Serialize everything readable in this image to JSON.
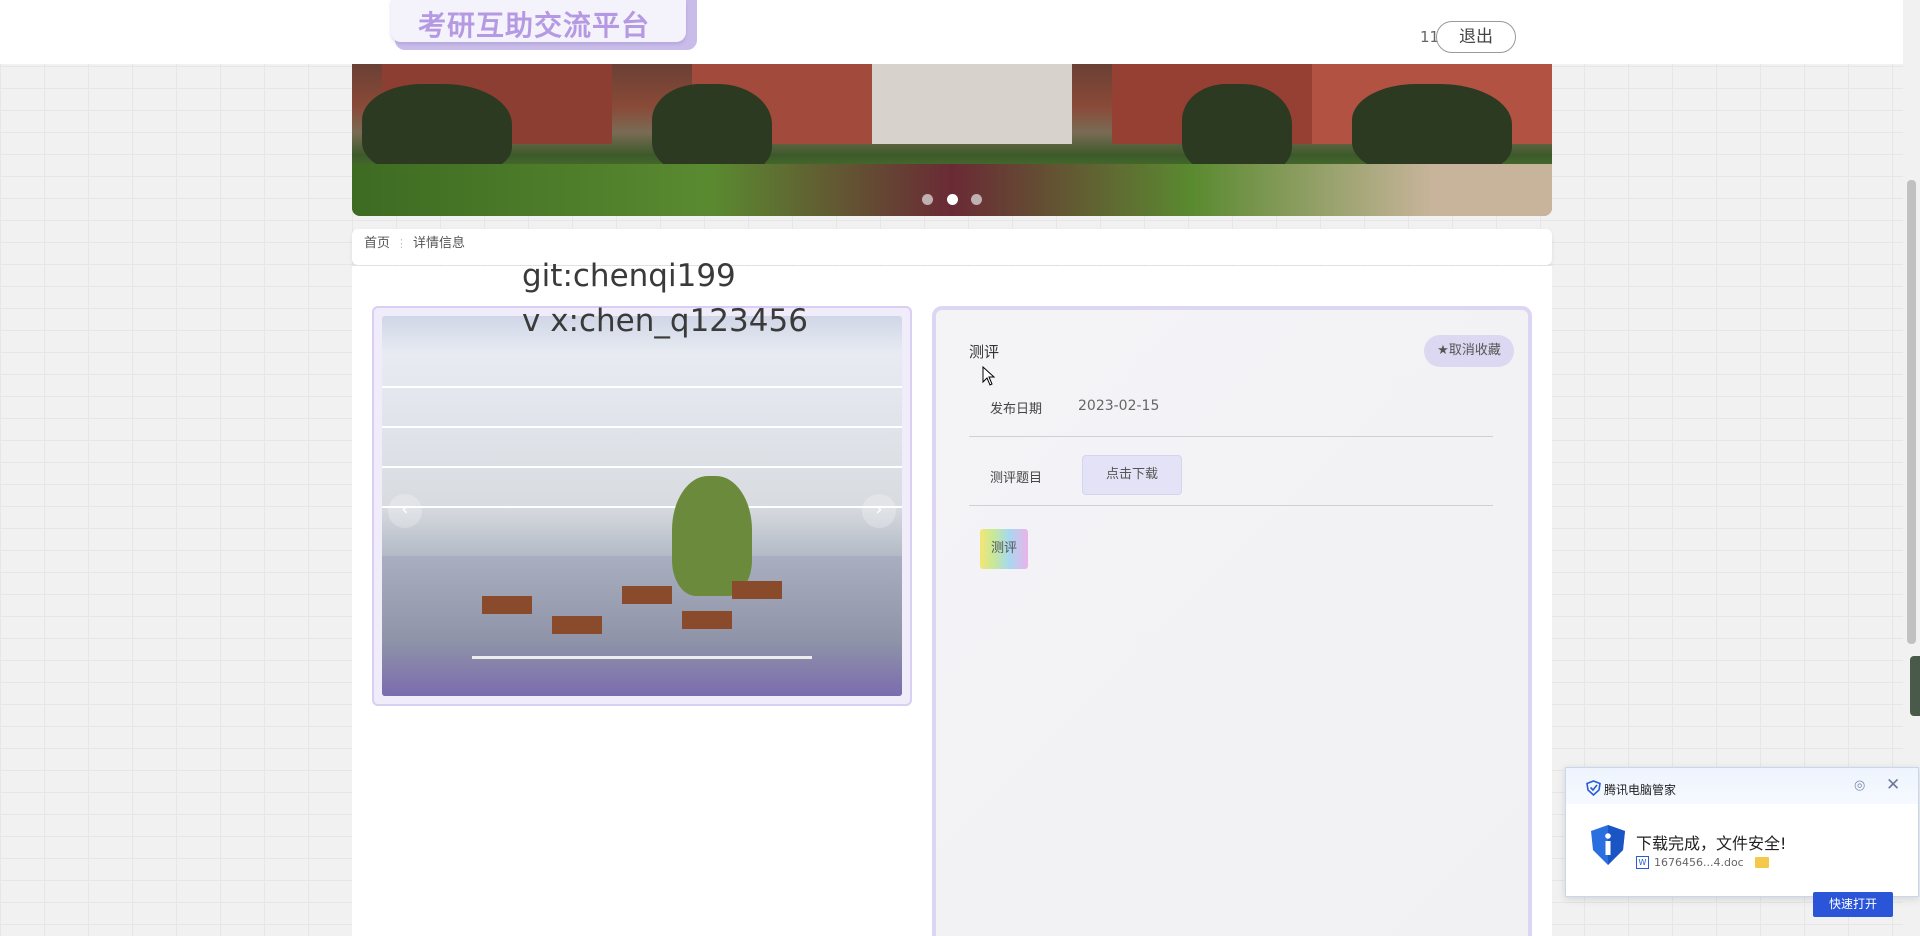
{
  "header": {
    "logo_text": "考研互助交流平台",
    "user_name": "11",
    "logout_label": "退出"
  },
  "banner": {
    "slide_count": 3,
    "active_slide": 2
  },
  "breadcrumb": {
    "home": "首页",
    "current": "详情信息"
  },
  "watermark": {
    "line1": "git:chenqi199",
    "line2": "v x:chen_q123456"
  },
  "detail": {
    "title": "测评",
    "favorite_label": "★取消收藏",
    "publish_date_label": "发布日期",
    "publish_date_value": "2023-02-15",
    "question_label": "测评题目",
    "download_label": "点击下载",
    "tag": "测评"
  },
  "carousel": {
    "prev_icon": "‹",
    "next_icon": "›"
  },
  "popup": {
    "app_name": "腾讯电脑管家",
    "message": "下载完成，文件安全!",
    "file_name": "1676456...4.doc",
    "open_label": "快速打开",
    "close_icon": "✕",
    "settings_icon": "◎"
  }
}
